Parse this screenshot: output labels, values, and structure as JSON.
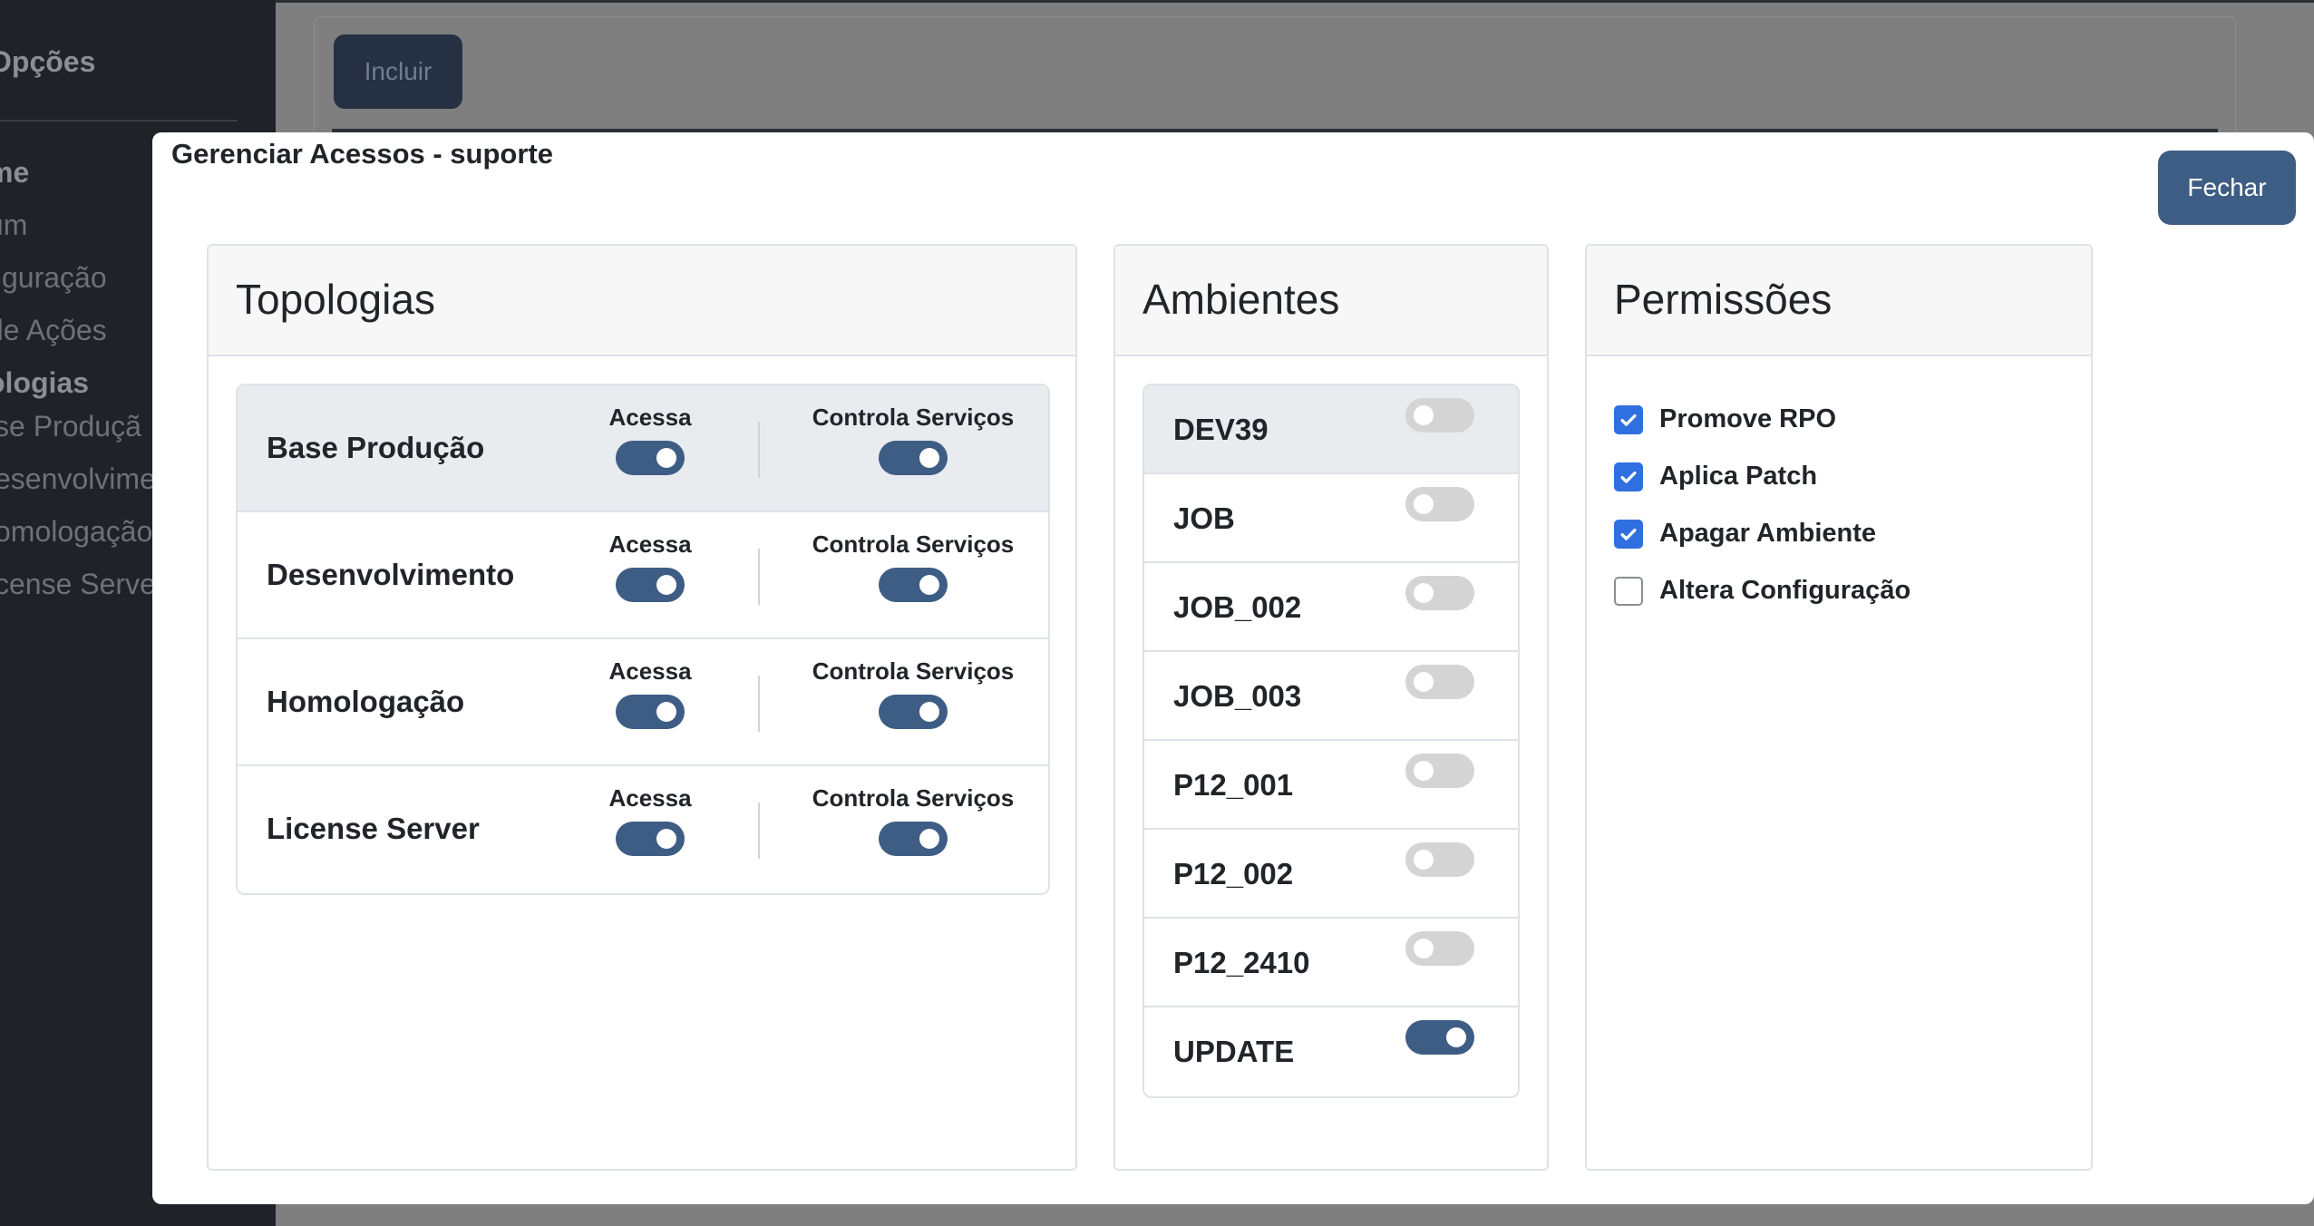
{
  "sidebar": {
    "title": "Opções",
    "items": [
      {
        "label": "me",
        "bold": true
      },
      {
        "label": "um",
        "bold": false
      },
      {
        "label": "figuração",
        "bold": false
      },
      {
        "label": " de Ações",
        "bold": false
      },
      {
        "label": "ologias",
        "bold": true
      },
      {
        "label": "se Produçã",
        "bold": false
      },
      {
        "label": "esenvolvime",
        "bold": false
      },
      {
        "label": "omologação",
        "bold": false
      },
      {
        "label": "cense Serve",
        "bold": false
      }
    ]
  },
  "main": {
    "include_label": "Incluir"
  },
  "modal": {
    "title": "Gerenciar Acessos - suporte",
    "close_label": "Fechar",
    "topologias": {
      "header": "Topologias",
      "col_acessa": "Acessa",
      "col_controla": "Controla Serviços",
      "rows": [
        {
          "name": "Base Produção",
          "acessa": true,
          "controla": true,
          "active": true
        },
        {
          "name": "Desenvolvimento",
          "acessa": true,
          "controla": true,
          "active": false
        },
        {
          "name": "Homologação",
          "acessa": true,
          "controla": true,
          "active": false
        },
        {
          "name": "License Server",
          "acessa": true,
          "controla": true,
          "active": false
        }
      ]
    },
    "ambientes": {
      "header": "Ambientes",
      "rows": [
        {
          "name": "DEV39",
          "enabled": false,
          "active": true
        },
        {
          "name": "JOB",
          "enabled": false,
          "active": false
        },
        {
          "name": "JOB_002",
          "enabled": false,
          "active": false
        },
        {
          "name": "JOB_003",
          "enabled": false,
          "active": false
        },
        {
          "name": "P12_001",
          "enabled": false,
          "active": false
        },
        {
          "name": "P12_002",
          "enabled": false,
          "active": false
        },
        {
          "name": "P12_2410",
          "enabled": false,
          "active": false
        },
        {
          "name": "UPDATE",
          "enabled": true,
          "active": false
        }
      ]
    },
    "permissoes": {
      "header": "Permissões",
      "items": [
        {
          "label": "Promove RPO",
          "checked": true
        },
        {
          "label": "Aplica Patch",
          "checked": true
        },
        {
          "label": "Apagar Ambiente",
          "checked": true
        },
        {
          "label": "Altera Configuração",
          "checked": false
        }
      ]
    }
  },
  "colors": {
    "accent": "#3e5d84",
    "checkbox": "#2f6fe0"
  }
}
